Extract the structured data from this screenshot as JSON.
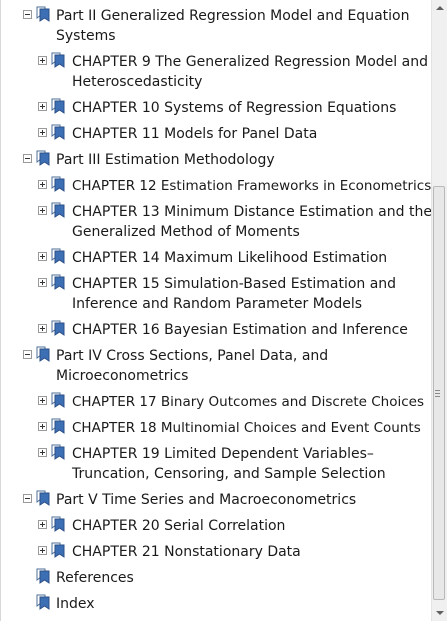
{
  "tree": [
    {
      "id": "part2",
      "lines": [
        "Part II Generalized Regression Model and Equation",
        "Systems"
      ]
    },
    {
      "id": "ch9",
      "lines": [
        "CHAPTER 9 The Generalized Regression Model and",
        "Heteroscedasticity"
      ]
    },
    {
      "id": "ch10",
      "lines": [
        "CHAPTER 10 Systems of Regression Equations"
      ]
    },
    {
      "id": "ch11",
      "lines": [
        "CHAPTER 11 Models for Panel Data"
      ]
    },
    {
      "id": "part3",
      "lines": [
        "Part III Estimation Methodology"
      ]
    },
    {
      "id": "ch12",
      "lines": [
        "CHAPTER 12 Estimation Frameworks in Econometrics"
      ]
    },
    {
      "id": "ch13",
      "lines": [
        "CHAPTER 13 Minimum Distance Estimation and the",
        "Generalized Method of Moments"
      ]
    },
    {
      "id": "ch14",
      "lines": [
        "CHAPTER 14 Maximum Likelihood Estimation"
      ]
    },
    {
      "id": "ch15",
      "lines": [
        "CHAPTER 15 Simulation-Based Estimation and",
        "Inference and Random Parameter Models"
      ]
    },
    {
      "id": "ch16",
      "lines": [
        "CHAPTER 16 Bayesian Estimation and Inference"
      ]
    },
    {
      "id": "part4",
      "lines": [
        "Part IV Cross Sections, Panel Data, and",
        "Microeconometrics"
      ]
    },
    {
      "id": "ch17",
      "lines": [
        "CHAPTER 17 Binary Outcomes and Discrete Choices"
      ]
    },
    {
      "id": "ch18",
      "lines": [
        "CHAPTER 18 Multinomial Choices and Event Counts"
      ]
    },
    {
      "id": "ch19",
      "lines": [
        "CHAPTER 19 Limited Dependent Variables–",
        "Truncation, Censoring, and Sample Selection"
      ]
    },
    {
      "id": "part5",
      "lines": [
        "Part V Time Series and Macroeconometrics"
      ]
    },
    {
      "id": "ch20",
      "lines": [
        "CHAPTER 20 Serial Correlation"
      ]
    },
    {
      "id": "ch21",
      "lines": [
        "CHAPTER 21 Nonstationary Data"
      ]
    },
    {
      "id": "references",
      "lines": [
        "References"
      ]
    },
    {
      "id": "index",
      "lines": [
        "Index"
      ]
    }
  ],
  "colors": {
    "bookmark_blue": "#3d6fb4",
    "bookmark_white": "#ffffff",
    "text": "#1a1a1a"
  }
}
